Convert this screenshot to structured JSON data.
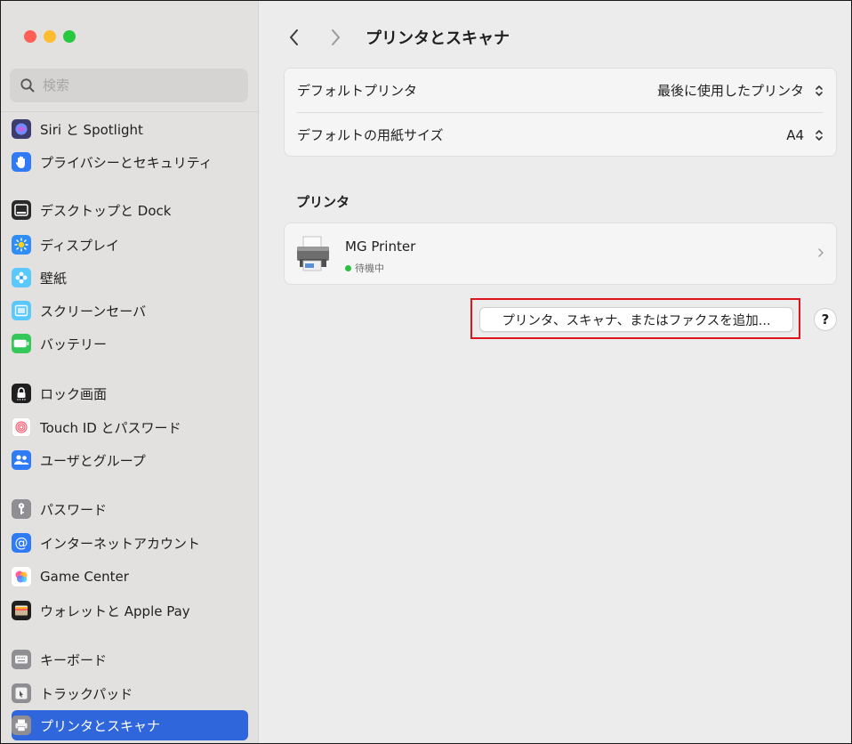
{
  "window": {
    "title": "プリンタとスキャナ",
    "traffic_lights": {
      "close": "#ff5f57",
      "minimize": "#febc2e",
      "zoom": "#28c840"
    }
  },
  "search": {
    "placeholder": "検索",
    "icon": "magnifier-icon"
  },
  "sidebar": {
    "items": [
      {
        "label": "Siri と Spotlight",
        "icon": "siri-icon",
        "color": "#3c3c6e"
      },
      {
        "label": "プライバシーとセキュリティ",
        "icon": "hand-icon",
        "color": "#2f7bf5"
      },
      {
        "label": "デスクトップと Dock",
        "icon": "dock-icon",
        "color": "#2a2a2a"
      },
      {
        "label": "ディスプレイ",
        "icon": "sun-icon",
        "color": "#2f8df5"
      },
      {
        "label": "壁紙",
        "icon": "flower-icon",
        "color": "#5ac8fa"
      },
      {
        "label": "スクリーンセーバ",
        "icon": "screensaver-icon",
        "color": "#5ac8fa"
      },
      {
        "label": "バッテリー",
        "icon": "battery-icon",
        "color": "#34c759"
      },
      {
        "label": "ロック画面",
        "icon": "lock-screen-icon",
        "color": "#1f1f1f"
      },
      {
        "label": "Touch ID とパスワード",
        "icon": "fingerprint-icon",
        "color": "#ff6b6b"
      },
      {
        "label": "ユーザとグループ",
        "icon": "users-icon",
        "color": "#2f7bf5"
      },
      {
        "label": "パスワード",
        "icon": "key-icon",
        "color": "#8e8e93"
      },
      {
        "label": "インターネットアカウント",
        "icon": "at-icon",
        "color": "#2f7bf5"
      },
      {
        "label": "Game Center",
        "icon": "game-center-icon",
        "color": "#ffffff"
      },
      {
        "label": "ウォレットと Apple Pay",
        "icon": "wallet-icon",
        "color": "#1f1f1f"
      },
      {
        "label": "キーボード",
        "icon": "keyboard-icon",
        "color": "#8e8e93"
      },
      {
        "label": "トラックパッド",
        "icon": "trackpad-icon",
        "color": "#8e8e93"
      },
      {
        "label": "プリンタとスキャナ",
        "icon": "printer-icon",
        "color": "#8e8e93",
        "selected": true
      }
    ]
  },
  "settings": {
    "default_printer_label": "デフォルトプリンタ",
    "default_printer_value": "最後に使用したプリンタ",
    "default_paper_label": "デフォルトの用紙サイズ",
    "default_paper_value": "A4"
  },
  "printers": {
    "section_title": "プリンタ",
    "items": [
      {
        "name": "MG Printer",
        "status": "待機中",
        "status_color": "#29c041"
      }
    ]
  },
  "actions": {
    "add_label": "プリンタ、スキャナ、またはファクスを追加...",
    "help_label": "?"
  },
  "highlight_color": "#e0141c",
  "accent_color": "#2f66db"
}
